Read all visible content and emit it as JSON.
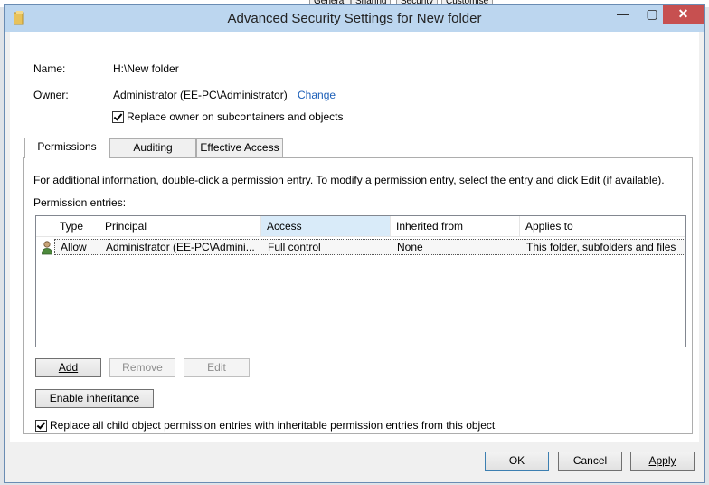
{
  "window": {
    "title": "Advanced Security Settings for New folder",
    "minimize_glyph": "—",
    "maximize_glyph": "▢",
    "close_glyph": "✕"
  },
  "background_tabs": [
    "General",
    "Sharing",
    "Security",
    "Customise"
  ],
  "info": {
    "name_label": "Name:",
    "name_value": "H:\\New folder",
    "owner_label": "Owner:",
    "owner_value": "Administrator (EE-PC\\Administrator)",
    "change_link": "Change",
    "replace_owner_label": "Replace owner on subcontainers and objects",
    "replace_owner_checked": true
  },
  "tabs": [
    {
      "label": "Permissions",
      "active": true
    },
    {
      "label": "Auditing",
      "active": false
    },
    {
      "label": "Effective Access",
      "active": false
    }
  ],
  "permissions": {
    "instructions": "For additional information, double-click a permission entry. To modify a permission entry, select the entry and click Edit (if available).",
    "entries_label": "Permission entries:",
    "columns": [
      "Type",
      "Principal",
      "Access",
      "Inherited from",
      "Applies to"
    ],
    "rows": [
      {
        "icon": "user-icon",
        "type": "Allow",
        "principal": "Administrator (EE-PC\\Admini...",
        "access": "Full control",
        "inherited_from": "None",
        "applies_to": "This folder, subfolders and files"
      }
    ],
    "buttons": {
      "add": "Add",
      "remove": "Remove",
      "edit": "Edit",
      "enable_inheritance": "Enable inheritance"
    },
    "replace_child_label": "Replace all child object permission entries with inheritable permission entries from this object",
    "replace_child_checked": true
  },
  "footer": {
    "ok": "OK",
    "cancel": "Cancel",
    "apply": "Apply"
  },
  "colors": {
    "titlebar": "#bcd6ef",
    "close_button": "#c75050",
    "link": "#1c5fb8"
  }
}
